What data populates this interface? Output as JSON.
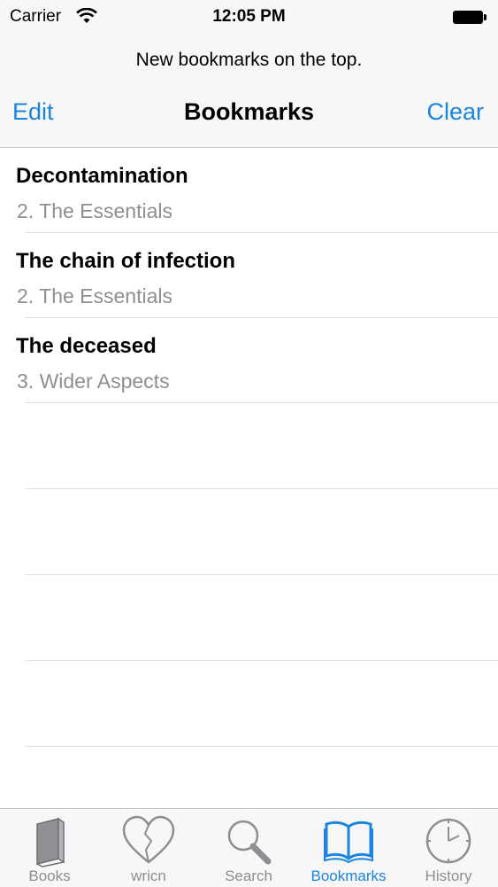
{
  "status_bar": {
    "carrier": "Carrier",
    "time": "12:05 PM"
  },
  "nav": {
    "prompt": "New bookmarks on the top.",
    "edit_label": "Edit",
    "title": "Bookmarks",
    "clear_label": "Clear"
  },
  "bookmarks": [
    {
      "title": "Decontamination",
      "chapter": "2. The Essentials"
    },
    {
      "title": "The chain of infection",
      "chapter": "2. The Essentials"
    },
    {
      "title": "The deceased",
      "chapter": "3. Wider Aspects"
    }
  ],
  "tabs": [
    {
      "label": "Books",
      "icon": "book-icon",
      "active": false
    },
    {
      "label": "wricn",
      "icon": "heart-icon",
      "active": false
    },
    {
      "label": "Search",
      "icon": "magnifier-icon",
      "active": false
    },
    {
      "label": "Bookmarks",
      "icon": "open-book-icon",
      "active": true
    },
    {
      "label": "History",
      "icon": "clock-icon",
      "active": false
    }
  ],
  "colors": {
    "accent": "#1a84e0",
    "inactive_tab": "#8e8e93",
    "bar_bg": "#f7f7f7"
  }
}
